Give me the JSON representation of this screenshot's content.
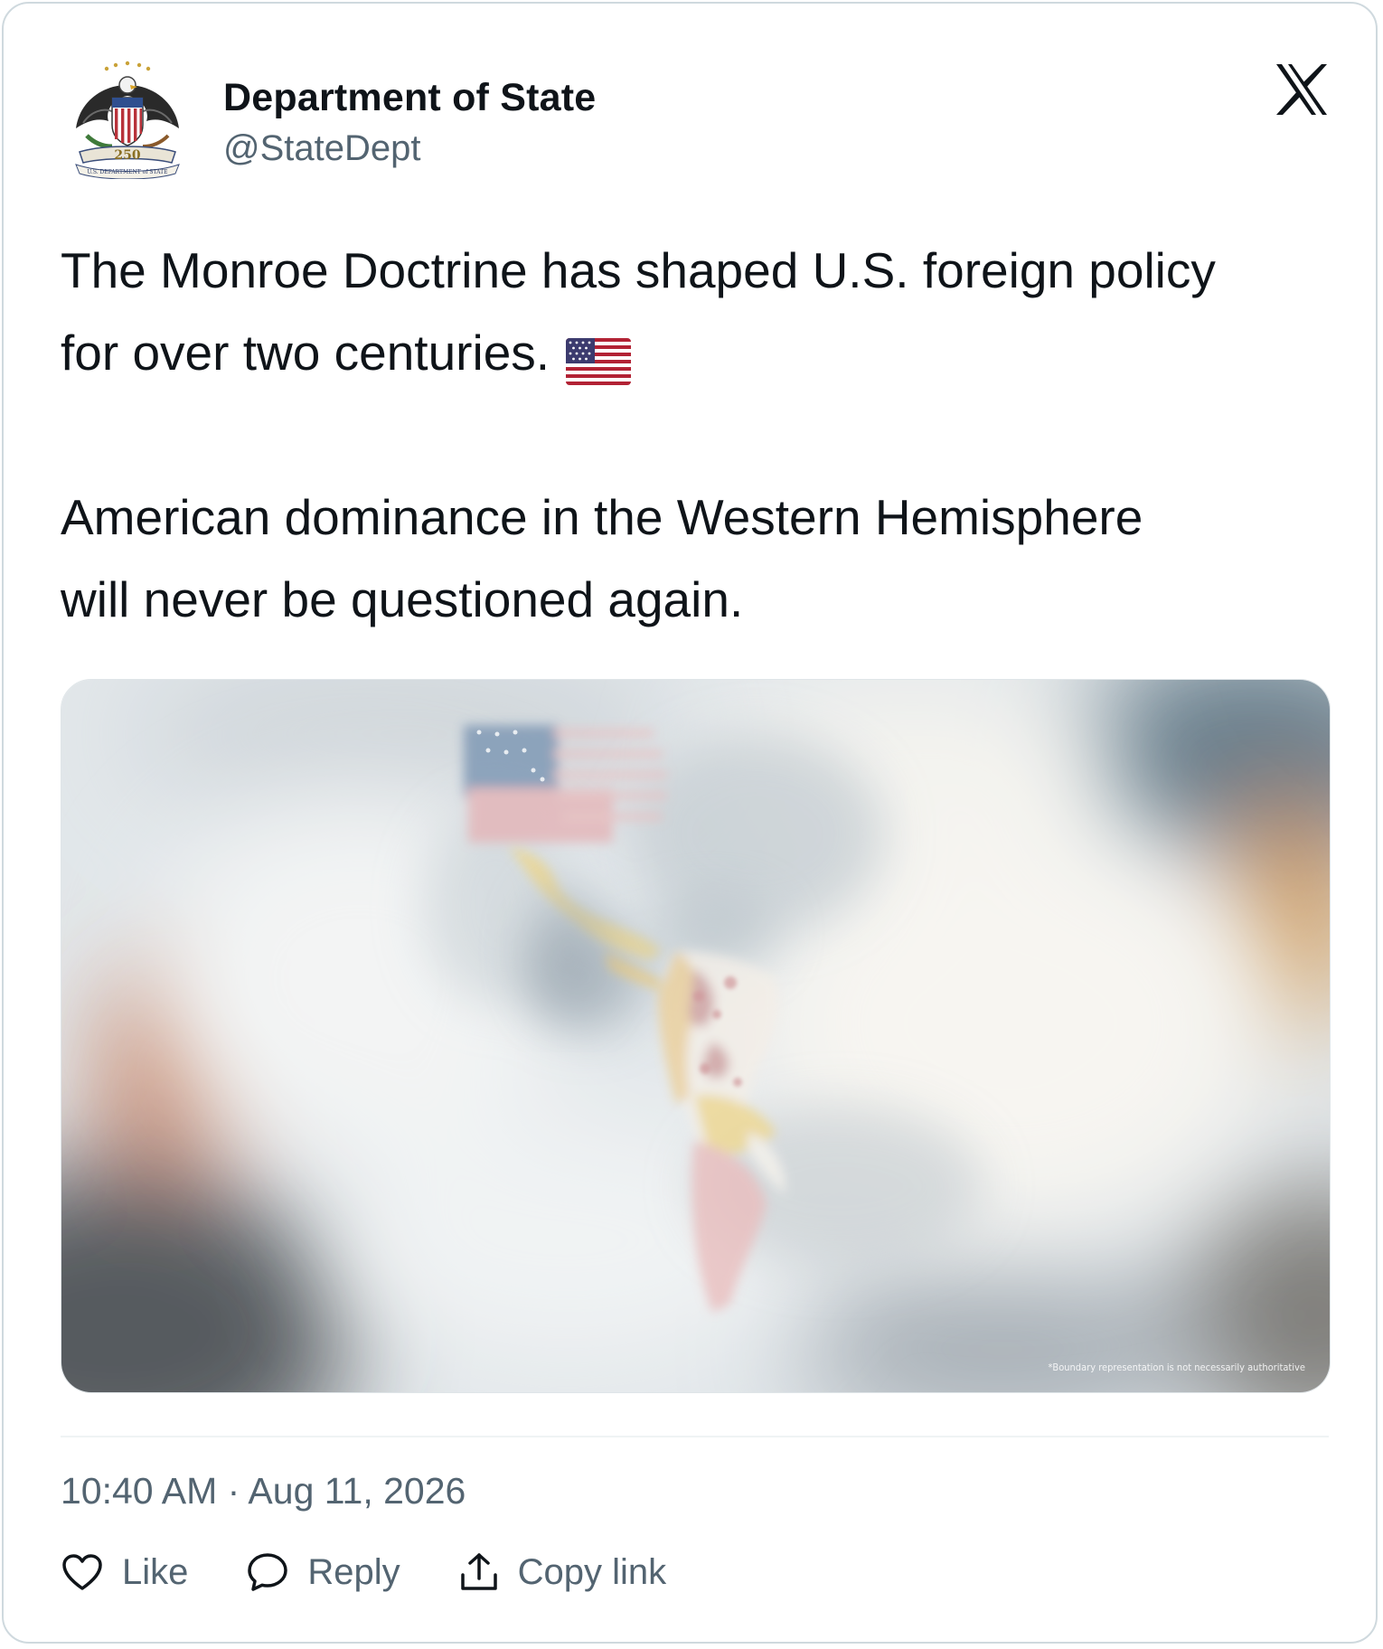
{
  "author": {
    "name": "Department of State",
    "handle": "@StateDept",
    "avatar_icon": "state-department-250-seal-icon",
    "seal_text": "250 U.S. DEPARTMENT of STATE"
  },
  "platform": {
    "logo_icon": "x-logo-icon"
  },
  "tweet": {
    "line_1": "The Monroe Doctrine has shaped U.S. foreign policy",
    "line_2": "for over two centuries.",
    "emoji": "us-flag-emoji",
    "line_3": "American dominance in the Western Hemisphere",
    "line_4": "will never be questioned again."
  },
  "media": {
    "description_icon": "western-hemisphere-map-image",
    "caption": "*Boundary representation is not necessarily authoritative"
  },
  "meta": {
    "time": "10:40 AM",
    "separator": " · ",
    "date": "Aug 11, 2026"
  },
  "actions": {
    "like_label": "Like",
    "reply_label": "Reply",
    "copy_label": "Copy link"
  },
  "colors": {
    "text_primary": "#0f1419",
    "text_secondary": "#536471",
    "border": "#cfd9de"
  }
}
